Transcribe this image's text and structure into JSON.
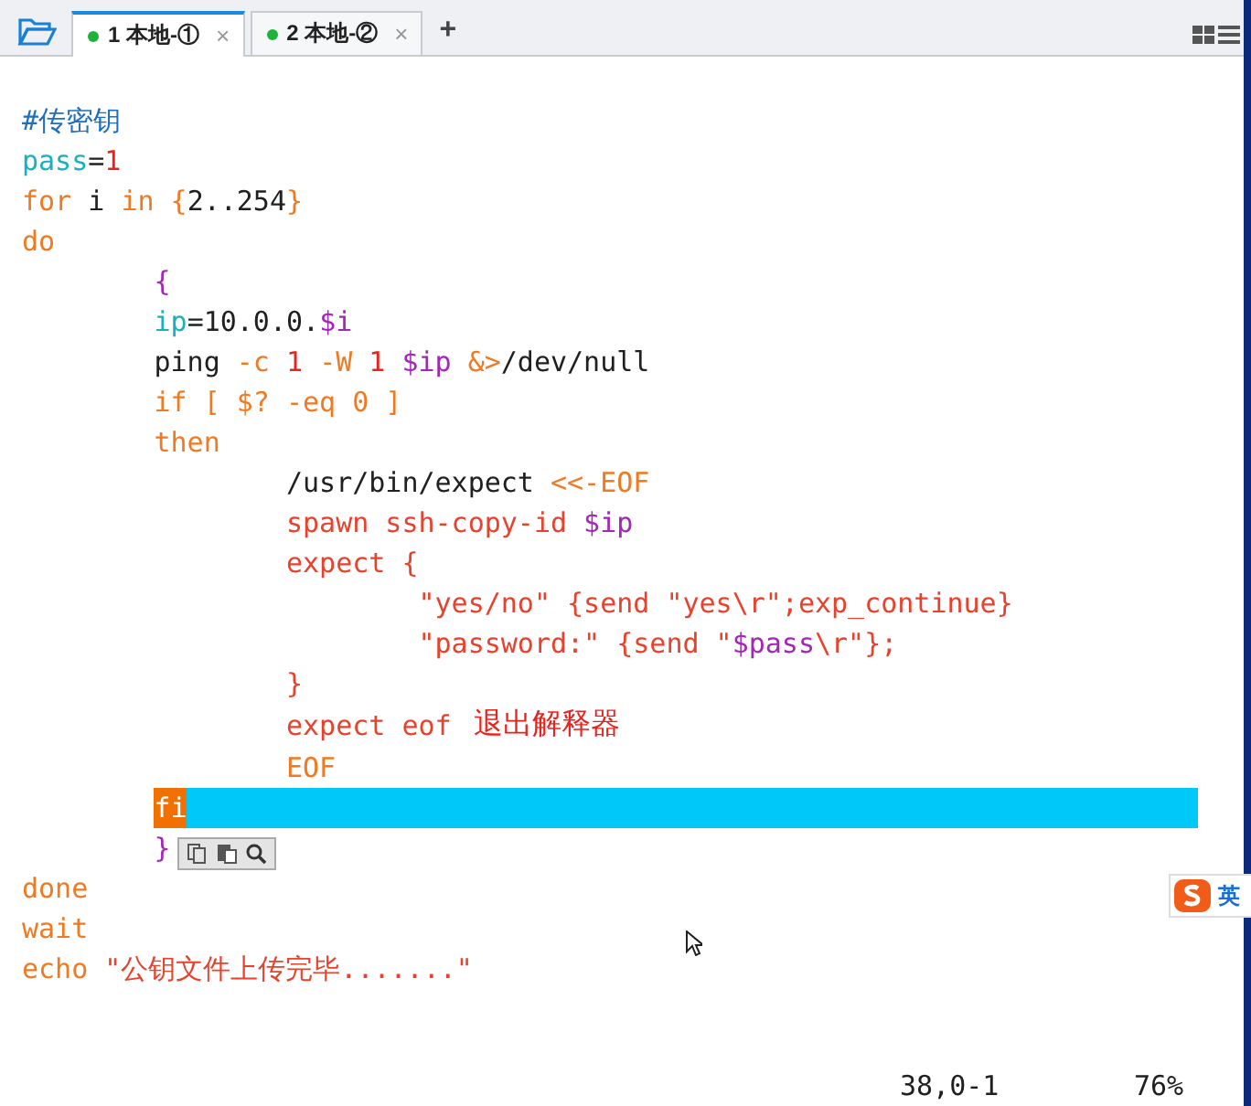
{
  "tabs": [
    {
      "label": "1 本地-①",
      "close": "×",
      "selected": true,
      "connected": true
    },
    {
      "label": "2 本地-②",
      "close": "×",
      "selected": false,
      "connected": true
    }
  ],
  "new_tab": "+",
  "editor": {
    "lines": [
      {
        "tokens": [
          {
            "text": "#传密钥",
            "kind": "comment"
          }
        ]
      },
      {
        "tokens": [
          {
            "text": "pass",
            "kind": "var"
          },
          {
            "text": "=",
            "kind": "plain"
          },
          {
            "text": "1",
            "kind": "num"
          }
        ]
      },
      {
        "tokens": [
          {
            "text": "for",
            "kind": "kw"
          },
          {
            "text": " i ",
            "kind": "plain"
          },
          {
            "text": "in",
            "kind": "kw"
          },
          {
            "text": " {",
            "kind": "kw"
          },
          {
            "text": "2..254",
            "kind": "plain"
          },
          {
            "text": "}",
            "kind": "kw"
          }
        ]
      },
      {
        "tokens": [
          {
            "text": "do",
            "kind": "kw"
          }
        ]
      },
      {
        "tokens": [
          {
            "text": "        {",
            "kind": "special"
          }
        ]
      },
      {
        "tokens": [
          {
            "text": "        ip",
            "kind": "var"
          },
          {
            "text": "=10.0.0.",
            "kind": "plain"
          },
          {
            "text": "$i",
            "kind": "special"
          }
        ]
      },
      {
        "tokens": [
          {
            "text": "        ping ",
            "kind": "plain"
          },
          {
            "text": "-c ",
            "kind": "kw"
          },
          {
            "text": "1 ",
            "kind": "num"
          },
          {
            "text": "-W ",
            "kind": "kw"
          },
          {
            "text": "1 ",
            "kind": "num"
          },
          {
            "text": "$ip ",
            "kind": "special"
          },
          {
            "text": "&>",
            "kind": "kw"
          },
          {
            "text": "/dev/null",
            "kind": "plain"
          }
        ]
      },
      {
        "tokens": [
          {
            "text": "        if [ $? -eq 0 ]",
            "kind": "kw"
          }
        ]
      },
      {
        "tokens": [
          {
            "text": "        then",
            "kind": "kw"
          }
        ]
      },
      {
        "tokens": [
          {
            "text": "                /usr/bin/expect ",
            "kind": "plain"
          },
          {
            "text": "<<-EOF",
            "kind": "kw"
          }
        ]
      },
      {
        "tokens": [
          {
            "text": "                spawn ssh-copy-id ",
            "kind": "str"
          },
          {
            "text": "$ip",
            "kind": "special"
          }
        ]
      },
      {
        "tokens": [
          {
            "text": "                expect {",
            "kind": "str"
          }
        ]
      },
      {
        "tokens": [
          {
            "text": "                        \"yes/no\" {send \"yes\\r\";exp_continue}",
            "kind": "str"
          }
        ]
      },
      {
        "tokens": [
          {
            "text": "                        \"password:\" {send \"",
            "kind": "str"
          },
          {
            "text": "$pass",
            "kind": "special"
          },
          {
            "text": "\\r\"};",
            "kind": "str"
          }
        ]
      },
      {
        "tokens": [
          {
            "text": "                }",
            "kind": "str"
          }
        ]
      },
      {
        "tokens": [
          {
            "text": "                expect eof",
            "kind": "str"
          }
        ],
        "note": "退出解释器"
      },
      {
        "tokens": [
          {
            "text": "                EOF",
            "kind": "kw"
          }
        ]
      },
      {
        "tokens": [
          {
            "text": "        fi",
            "kind": "cursor"
          }
        ],
        "highlighted": true
      },
      {
        "tokens": [
          {
            "text": "        }",
            "kind": "special"
          }
        ]
      },
      {
        "tokens": [
          {
            "text": "done",
            "kind": "kw"
          }
        ]
      },
      {
        "tokens": [
          {
            "text": "wait",
            "kind": "kw"
          }
        ]
      },
      {
        "tokens": [
          {
            "text": "echo ",
            "kind": "kw"
          },
          {
            "text": "\"公钥文件上传完毕.......\"",
            "kind": "str"
          }
        ]
      }
    ]
  },
  "ime": {
    "label": "英"
  },
  "status_bar": {
    "position": "38,0-1",
    "percent": "76%"
  }
}
